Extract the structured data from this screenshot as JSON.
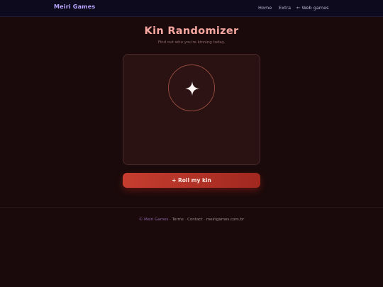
{
  "nav": {
    "brand": "Meiri Games",
    "links": {
      "home": "Home",
      "extra": "Extra",
      "web_games_arrow": "←",
      "web_games": "Web games"
    }
  },
  "header": {
    "title": "Kin Randomizer",
    "subtitle": "Find out who you're kinning today."
  },
  "card": {
    "icon": "sparkle-icon"
  },
  "roll_button": {
    "label": "+ Roll my kin"
  },
  "footer": {
    "copyright": "© Meiri Games",
    "sep1": " · ",
    "terms": "Terms",
    "sep2": " · ",
    "contact": "Contact",
    "sep3": " · ",
    "site": "meirigames.com.br"
  },
  "colors": {
    "background": "#1a0a0b",
    "navbar": "#0c0a1c",
    "brand": "#b9a6ff",
    "title": "#f7a7a0",
    "button_start": "#c63d2f",
    "button_end": "#a1281f"
  }
}
